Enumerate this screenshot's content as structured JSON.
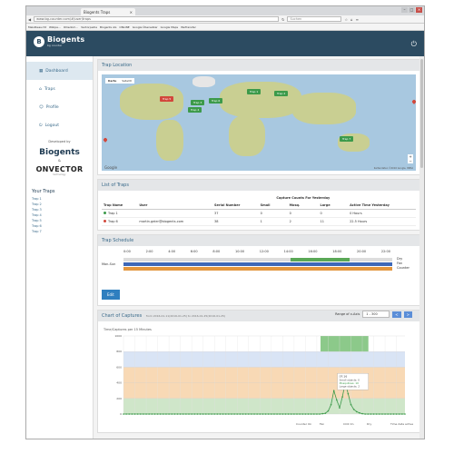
{
  "browser": {
    "tab_title": "Biogents Traps",
    "url": "www.bg-counter.com/#/user/traps",
    "search_placeholder": "Suchen",
    "bookmarks": [
      "Meistbesucht",
      "Wikipe...",
      "Olliedom...",
      "Vectorpedia",
      "Biogents AG",
      "ONLINE",
      "Google Übersetzer",
      "Google Maps",
      "WeTransfer"
    ]
  },
  "app": {
    "brand": "Biogents",
    "brand_sub": "bg counter"
  },
  "sidebar": {
    "items": [
      {
        "label": "Dashboard",
        "icon": "dashboard-icon"
      },
      {
        "label": "Traps",
        "icon": "trap-icon"
      },
      {
        "label": "Profile",
        "icon": "profile-icon"
      },
      {
        "label": "Logout",
        "icon": "logout-icon"
      }
    ],
    "developed_by": "Developed by",
    "biogents": "Biogents",
    "and": "&",
    "onvector": "ONVECTOR",
    "onvector_sub": "technology",
    "your_traps_title": "Your Traps",
    "traps": [
      "Trap 1",
      "Trap 2",
      "Trap 3",
      "Trap 4",
      "Trap 5",
      "Trap 6",
      "Trap 7"
    ]
  },
  "map_panel": {
    "title": "Trap Location",
    "map_type": [
      "Karte",
      "Satellit"
    ],
    "markers": [
      {
        "label": "Trap 5",
        "color": "red"
      },
      {
        "label": "Trap 1",
        "color": "green"
      },
      {
        "label": "Trap 2",
        "color": "green"
      },
      {
        "label": "Trap 3",
        "color": "green"
      },
      {
        "label": "Trap 4",
        "color": "green"
      },
      {
        "label": "Trap 6",
        "color": "green"
      },
      {
        "label": "Trap 7",
        "color": "green"
      }
    ],
    "google": "Google",
    "footer": "Kartendaten ©2016 Google, INEGI"
  },
  "traps_table": {
    "title": "List of Traps",
    "group_header": "Capture Counts For Yesterday",
    "columns": [
      "Trap Name",
      "User",
      "Serial Number",
      "Small",
      "Mosq.",
      "Large",
      "Active Time Yesterday"
    ],
    "rows": [
      {
        "name": "Trap 1",
        "status": "#3c9a4a",
        "user": "",
        "serial": "37",
        "small": "0",
        "mosq": "0",
        "large": "0",
        "active": "0 Hours"
      },
      {
        "name": "Trap 6",
        "status": "#d2473b",
        "user": "martin.geier@biogents.com",
        "serial": "38",
        "small": "1",
        "mosq": "2",
        "large": "11",
        "active": "22.5 Hours"
      }
    ]
  },
  "schedule": {
    "title": "Trap Schedule",
    "hours": [
      "0:00",
      "2:00",
      "4:00",
      "6:00",
      "8:00",
      "10:00",
      "12:00",
      "14:00",
      "16:00",
      "18:00",
      "20:00",
      "22:00"
    ],
    "day_label": "Mon-Sun",
    "legend": [
      "Dry",
      "Fan",
      "Counter"
    ],
    "edit_label": "Edit"
  },
  "captures": {
    "title": "Chart of Captures",
    "subtitle": "from 2016-01-11(2016-01-25) to 2016-01-25(2016-01-25)",
    "range_label": "Range of x-Axis",
    "range_value": "1 - 300",
    "prev": "<",
    "next": ">"
  },
  "chart_data": {
    "type": "line",
    "title": "",
    "ylabel": "Time/Captures per 15 Minutes",
    "ylim": [
      0,
      1000
    ],
    "y_ticks": [
      "0",
      "200",
      "400",
      "600",
      "800",
      "1000"
    ],
    "bands": [
      {
        "name": "Large objects",
        "from": 200,
        "to": 600,
        "color": "#f8d9b5"
      },
      {
        "name": "Mosquitoes",
        "from": 0,
        "to": 200,
        "color": "#cfe6c9"
      },
      {
        "name": "Small objects",
        "from": 600,
        "to": 800,
        "color": "#d9e4f5"
      }
    ],
    "active_block": {
      "from": 0.7,
      "to": 0.87,
      "color": "#8cc98a"
    },
    "series": [
      {
        "name": "Mosquitoes",
        "color": "#3c9a4a",
        "values": [
          0,
          0,
          0,
          0,
          0,
          0,
          0,
          0,
          0,
          0,
          0,
          0,
          0,
          0,
          0,
          0,
          0,
          0,
          0,
          0,
          0,
          0,
          0,
          0,
          0,
          0,
          0,
          0,
          0,
          0,
          0,
          0,
          0,
          0,
          0,
          0,
          0,
          0,
          0,
          0,
          0,
          0,
          0,
          0,
          0,
          0,
          0,
          0,
          0,
          0,
          0,
          0,
          0,
          0,
          0,
          0,
          0,
          0,
          0,
          0,
          0,
          0,
          0,
          0,
          0,
          0,
          0,
          0,
          0,
          0,
          5,
          10,
          40,
          120,
          300,
          180,
          80,
          220,
          400,
          260,
          120,
          60,
          30,
          15,
          5,
          0,
          0,
          0,
          0,
          0,
          0,
          0,
          0,
          0,
          0,
          0,
          0,
          0,
          0,
          0
        ]
      }
    ],
    "tooltip": {
      "title": "07:16",
      "lines": [
        "Small objects: 0",
        "Mosquitoes: 10",
        "Large objects: 2"
      ]
    },
    "legend": [
      "Counter On",
      "Fan",
      "CO2 On",
      "Dry",
      "Time data active"
    ]
  }
}
